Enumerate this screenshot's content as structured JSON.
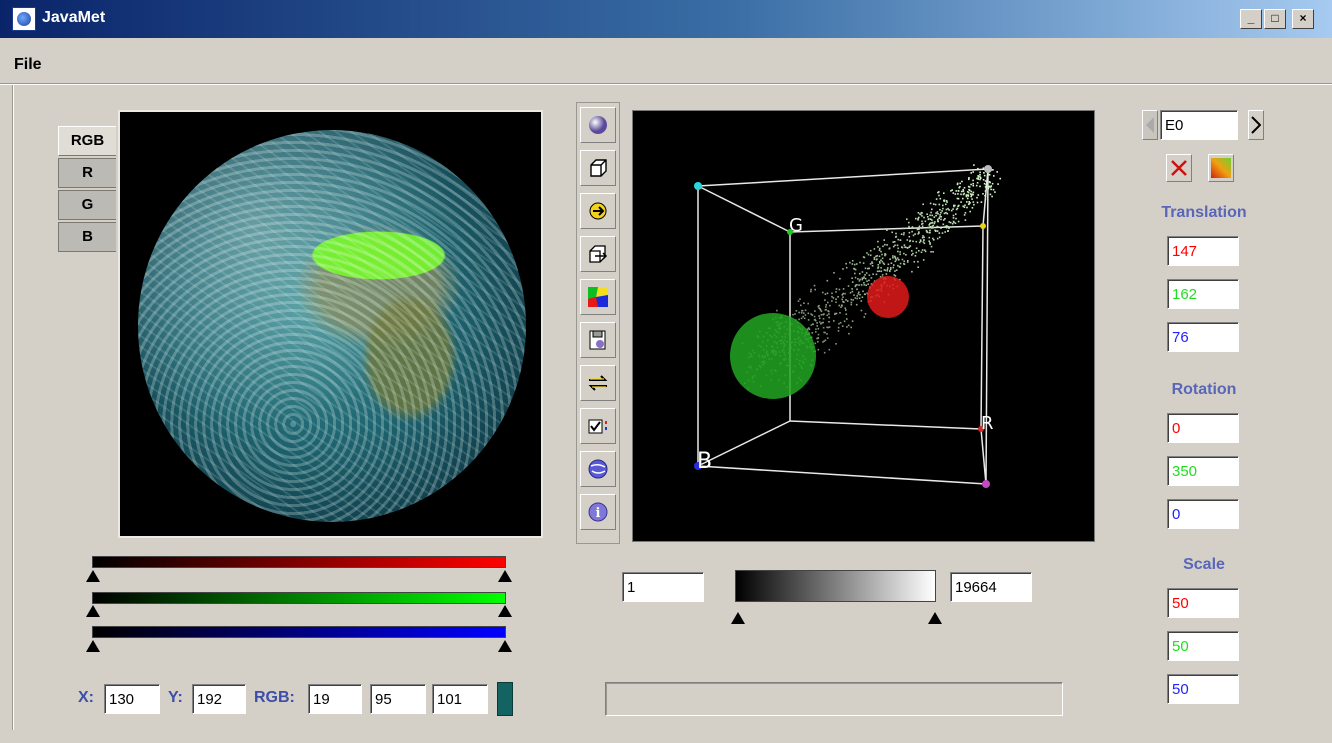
{
  "window": {
    "title": "JavaMet",
    "minimize": "_",
    "maximize": "□",
    "close": "×"
  },
  "menu": {
    "file": "File"
  },
  "tabs": [
    {
      "label": "RGB",
      "active": true
    },
    {
      "label": "R"
    },
    {
      "label": "G"
    },
    {
      "label": "B"
    }
  ],
  "toolbar": [
    "sphere-icon",
    "cube-icon",
    "rotate-icon",
    "box-arrow-icon",
    "color-regions-icon",
    "save-icon",
    "swap-arrows-icon",
    "checkbox-list-icon",
    "globe-icon",
    "info-icon"
  ],
  "scatter": {
    "axis_labels": {
      "g": "G",
      "r": "R",
      "b": "B"
    },
    "colors": {
      "green_sphere": "#22a722",
      "red_sphere": "#e21a1a"
    }
  },
  "range": {
    "min": "1",
    "max": "19664"
  },
  "coords": {
    "x_label": "X:",
    "x": "130",
    "y_label": "Y:",
    "y": "192",
    "rgb_label": "RGB:",
    "r": "19",
    "g": "95",
    "b": "101",
    "swatch_color": "#136363"
  },
  "right_panel": {
    "cluster_value": "E0",
    "translation_title": "Translation",
    "translation": [
      "147",
      "162",
      "76"
    ],
    "rotation_title": "Rotation",
    "rotation": [
      "0",
      "350",
      "0"
    ],
    "scale_title": "Scale",
    "scale": [
      "50",
      "50",
      "50"
    ],
    "channel_colors": [
      "#ff0000",
      "#22dd22",
      "#2222ff"
    ]
  }
}
